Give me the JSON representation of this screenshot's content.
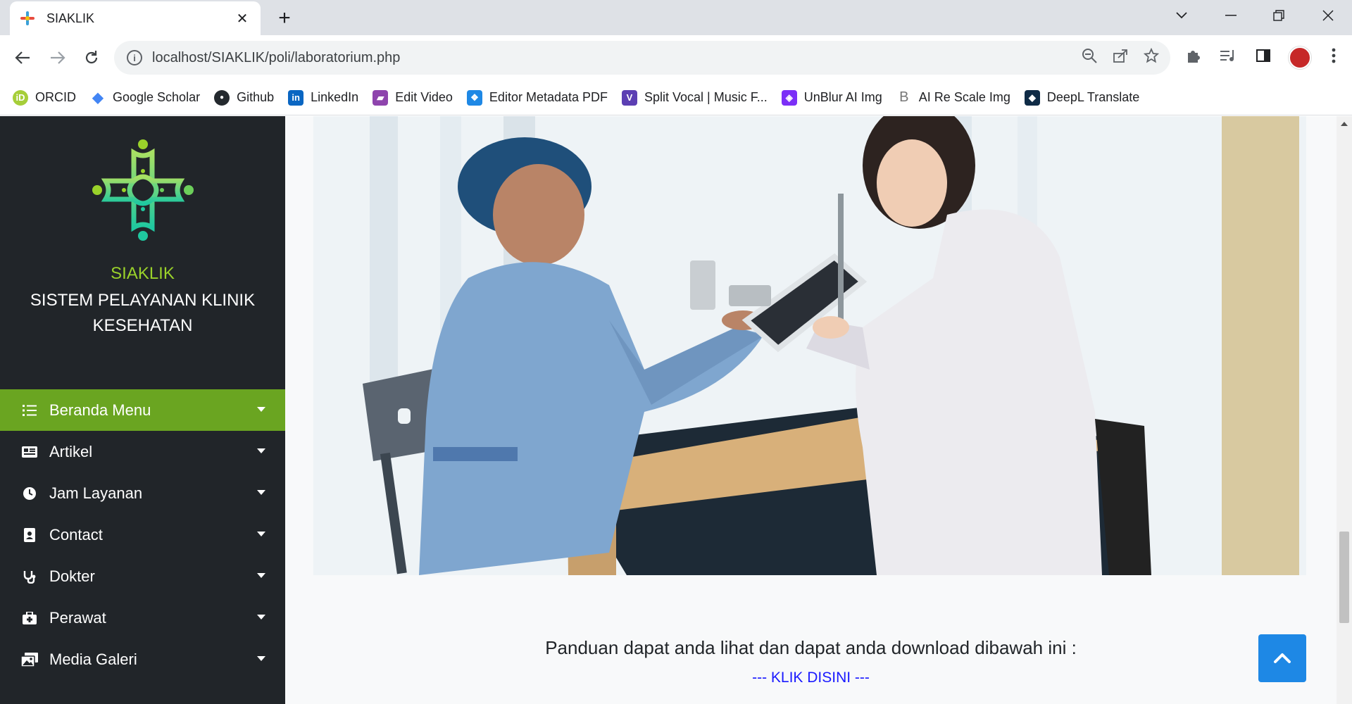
{
  "browser": {
    "tab_title": "SIAKLIK",
    "tab_close": "✕",
    "new_tab": "+",
    "url": "localhost/SIAKLIK/poli/laboratorium.php",
    "bookmarks": [
      {
        "label": "ORCID",
        "icon": "orcid-icon",
        "color": "#a6ce39",
        "glyph": "iD"
      },
      {
        "label": "Google Scholar",
        "icon": "google-scholar-icon",
        "color": "#4285f4",
        "glyph": "◆"
      },
      {
        "label": "Github",
        "icon": "github-icon",
        "color": "#24292e",
        "glyph": "●"
      },
      {
        "label": "LinkedIn",
        "icon": "linkedin-icon",
        "color": "#0a66c2",
        "glyph": "in"
      },
      {
        "label": "Edit Video",
        "icon": "edit-video-icon",
        "color": "#8e44ad",
        "glyph": "▰"
      },
      {
        "label": "Editor Metadata PDF",
        "icon": "metadata-pdf-icon",
        "color": "#1e88e5",
        "glyph": "❖"
      },
      {
        "label": "Split Vocal | Music F...",
        "icon": "split-vocal-icon",
        "color": "#5c3fb3",
        "glyph": "V"
      },
      {
        "label": "UnBlur AI Img",
        "icon": "unblur-icon",
        "color": "#7b2ff7",
        "glyph": "◈"
      },
      {
        "label": "AI Re Scale Img",
        "icon": "rescale-icon",
        "color": "#777777",
        "glyph": "B"
      },
      {
        "label": "DeepL Translate",
        "icon": "deepl-icon",
        "color": "#0f2b46",
        "glyph": "◆"
      }
    ]
  },
  "sidebar": {
    "brand_name": "SIAKLIK",
    "brand_subtitle": "SISTEM PELAYANAN KLINIK KESEHATAN",
    "menu": [
      {
        "label": "Beranda Menu",
        "icon": "list-icon",
        "active": true
      },
      {
        "label": "Artikel",
        "icon": "newspaper-icon",
        "active": false
      },
      {
        "label": "Jam Layanan",
        "icon": "clock-icon",
        "active": false
      },
      {
        "label": "Contact",
        "icon": "contact-card-icon",
        "active": false
      },
      {
        "label": "Dokter",
        "icon": "stethoscope-icon",
        "active": false
      },
      {
        "label": "Perawat",
        "icon": "medkit-icon",
        "active": false
      },
      {
        "label": "Media Galeri",
        "icon": "images-icon",
        "active": false
      }
    ]
  },
  "main": {
    "panduan_text": "Panduan dapat anda lihat dan dapat anda download dibawah ini :",
    "download_link": "--- KLIK DISINI ---"
  },
  "colors": {
    "sidebar_bg": "#212529",
    "accent_green": "#6aa521",
    "brand_green": "#9ad22a",
    "scroll_button_blue": "#1e88e5",
    "link_blue": "#1a1aff"
  }
}
